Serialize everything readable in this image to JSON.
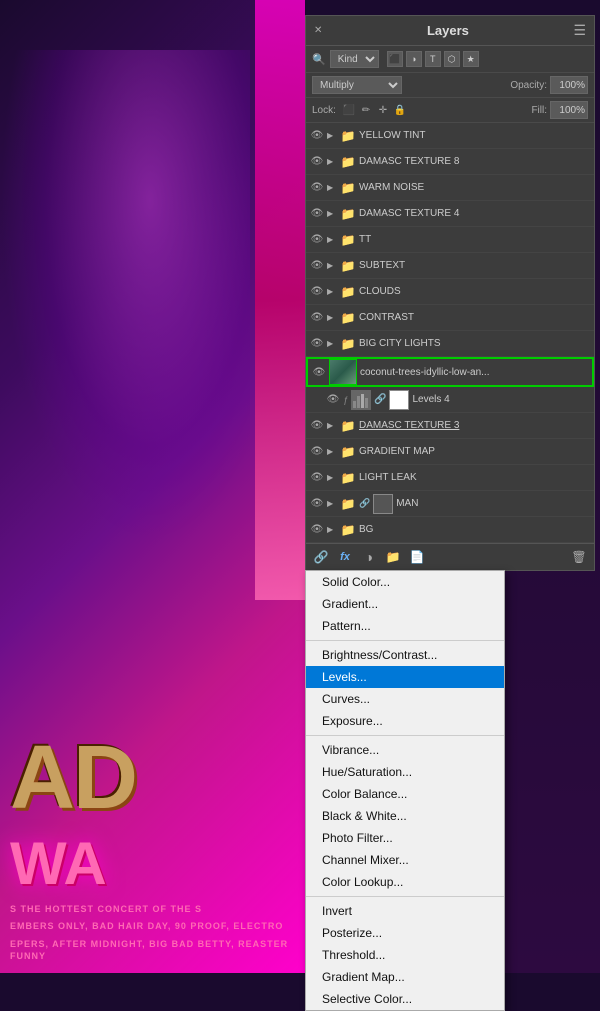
{
  "panel": {
    "title": "Layers",
    "menu_icon": "☰",
    "close_icon": "✕",
    "kind_label": "Kind",
    "blend_mode": "Multiply",
    "opacity_label": "Opacity:",
    "opacity_value": "100%",
    "lock_label": "Lock:",
    "fill_label": "Fill:",
    "fill_value": "100%"
  },
  "layers": [
    {
      "name": "YELLOW TINT",
      "type": "folder",
      "visible": true,
      "indent": 0
    },
    {
      "name": "DAMASC TEXTURE 8",
      "type": "folder",
      "visible": true,
      "indent": 0
    },
    {
      "name": "WARM NOISE",
      "type": "folder",
      "visible": true,
      "indent": 0
    },
    {
      "name": "DAMASC TEXTURE 4",
      "type": "folder",
      "visible": true,
      "indent": 0
    },
    {
      "name": "TT",
      "type": "folder",
      "visible": true,
      "indent": 0
    },
    {
      "name": "SUBTEXT",
      "type": "folder",
      "visible": true,
      "indent": 0
    },
    {
      "name": "CLOUDS",
      "type": "folder",
      "visible": true,
      "indent": 0
    },
    {
      "name": "CONTRAST",
      "type": "folder",
      "visible": true,
      "indent": 0
    },
    {
      "name": "BIG CITY LIGHTS",
      "type": "folder",
      "visible": true,
      "indent": 0
    },
    {
      "name": "coconut-trees-idyllic-low-an...",
      "type": "image",
      "visible": true,
      "indent": 0,
      "highlighted": true
    },
    {
      "name": "Levels 4",
      "type": "levels",
      "visible": true,
      "indent": 1
    },
    {
      "name": "DAMASC TEXTURE 3",
      "type": "folder",
      "visible": true,
      "indent": 0,
      "underline": true
    },
    {
      "name": "GRADIENT MAP",
      "type": "folder",
      "visible": true,
      "indent": 0
    },
    {
      "name": "LIGHT LEAK",
      "type": "folder",
      "visible": true,
      "indent": 0
    },
    {
      "name": "MAN",
      "type": "folder-mask",
      "visible": true,
      "indent": 0
    },
    {
      "name": "BG",
      "type": "folder",
      "visible": true,
      "indent": 0
    }
  ],
  "bottom_toolbar": {
    "link_icon": "🔗",
    "fx_icon": "fx",
    "adjustment_icon": "◑",
    "new_group_icon": "📁",
    "new_layer_icon": "📄",
    "delete_icon": "🗑"
  },
  "dropdown": {
    "items": [
      {
        "label": "Solid Color...",
        "group": 1
      },
      {
        "label": "Gradient...",
        "group": 1
      },
      {
        "label": "Pattern...",
        "group": 1
      },
      {
        "label": "Brightness/Contrast...",
        "group": 2
      },
      {
        "label": "Levels...",
        "group": 2,
        "selected": true
      },
      {
        "label": "Curves...",
        "group": 2
      },
      {
        "label": "Exposure...",
        "group": 2
      },
      {
        "label": "Vibrance...",
        "group": 3
      },
      {
        "label": "Hue/Saturation...",
        "group": 3
      },
      {
        "label": "Color Balance...",
        "group": 3
      },
      {
        "label": "Black & White...",
        "group": 3
      },
      {
        "label": "Photo Filter...",
        "group": 3
      },
      {
        "label": "Channel Mixer...",
        "group": 3
      },
      {
        "label": "Color Lookup...",
        "group": 3
      },
      {
        "label": "Invert",
        "group": 4
      },
      {
        "label": "Posterize...",
        "group": 4
      },
      {
        "label": "Threshold...",
        "group": 4
      },
      {
        "label": "Gradient Map...",
        "group": 4
      },
      {
        "label": "Selective Color...",
        "group": 4
      }
    ]
  },
  "poster": {
    "big_text": "AD",
    "wa_text": "WA",
    "subtitle1": "S THE HOTTEST CONCERT OF THE S",
    "subtitle2": "EMBERS ONLY, BAD HAIR DAY, 90 PROOF, ELECTRO",
    "subtitle3": "EPERS, AFTER MIDNIGHT, BIG BAD BETTY, REASTER FUNNY"
  }
}
